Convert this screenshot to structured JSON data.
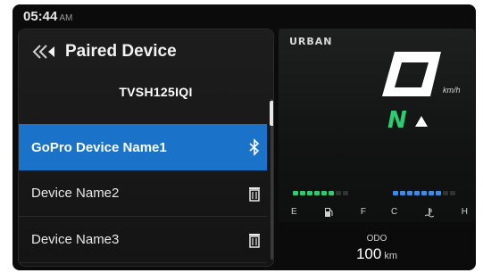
{
  "status": {
    "time": "05:44",
    "ampm": "AM"
  },
  "paired": {
    "title": "Paired Device",
    "device_id": "TVSH125IQI",
    "devices": [
      {
        "name": "GoPro Device Name1",
        "selected": true,
        "icon": "bluetooth-icon"
      },
      {
        "name": "Device Name2",
        "selected": false,
        "icon": "delete-icon"
      },
      {
        "name": "Device Name3",
        "selected": false,
        "icon": "delete-icon"
      }
    ]
  },
  "cluster": {
    "mode": "URBAN",
    "speed": "0",
    "speed_unit": "km/h",
    "gear": "N",
    "fuel_gauge": {
      "left_label": "E",
      "right_label": "F",
      "filled": 6,
      "total": 8,
      "color": "#2ecc71"
    },
    "temp_gauge": {
      "left_label": "C",
      "right_label": "H",
      "filled": 7,
      "total": 9,
      "color": "#3a8ee6"
    }
  },
  "odo": {
    "label": "ODO",
    "value": "100",
    "unit": "km"
  },
  "colors": {
    "accent": "#1a73c8",
    "gear": "#2ecc71"
  }
}
